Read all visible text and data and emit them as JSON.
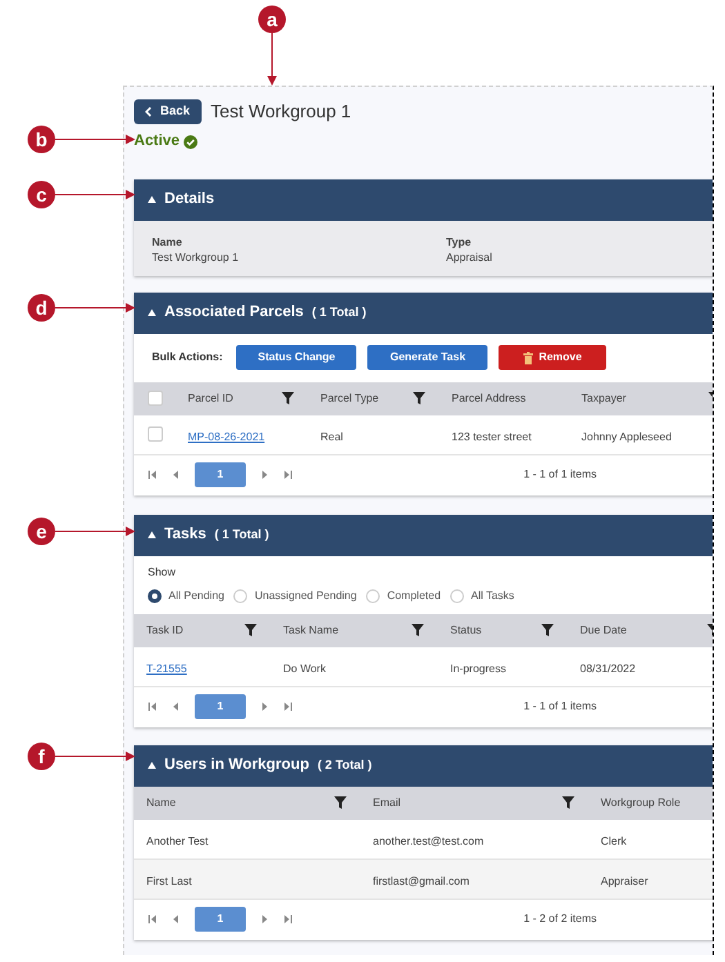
{
  "annotations": [
    {
      "label": "a"
    },
    {
      "label": "b"
    },
    {
      "label": "c"
    },
    {
      "label": "d"
    },
    {
      "label": "e"
    },
    {
      "label": "f"
    }
  ],
  "header": {
    "back_button": "Back",
    "title": "Test Workgroup 1",
    "status": "Active",
    "active": true
  },
  "sections": [
    {
      "kind": "details",
      "title": "Details",
      "expanded": true,
      "fields": [
        {
          "label": "Name",
          "value": "Test Workgroup 1"
        },
        {
          "label": "Type",
          "value": "Appraisal"
        }
      ]
    },
    {
      "kind": "table",
      "title": "Associated Parcels",
      "count": "( 1 Total )",
      "expanded": true,
      "bulk_actions": {
        "label": "Bulk Actions:",
        "buttons": [
          {
            "label": "Status Change",
            "kind": "primary"
          },
          {
            "label": "Generate Task",
            "kind": "primary"
          },
          {
            "label": "Remove",
            "kind": "danger"
          }
        ]
      },
      "select_all": {
        "checked": false
      },
      "columns": [
        {
          "label": "Parcel ID",
          "filter": true,
          "link": true
        },
        {
          "label": "Parcel Type",
          "filter": true,
          "link": false
        },
        {
          "label": "Parcel Address",
          "filter": false,
          "link": false
        },
        {
          "label": "Taxpayer",
          "filter": true,
          "link": false
        }
      ],
      "rows": [
        {
          "checked": false,
          "cells": [
            "MP-08-26-2021",
            "Real",
            "123 tester street",
            "Johnny Appleseed"
          ]
        }
      ],
      "pager": {
        "pages": [
          {
            "label": "1",
            "selected": true
          }
        ],
        "summary": "1 - 1 of 1 items"
      }
    },
    {
      "kind": "table",
      "title": "Tasks",
      "count": "( 1 Total )",
      "expanded": true,
      "filter_options": {
        "label": "Show",
        "options": [
          {
            "label": "All Pending",
            "selected": true
          },
          {
            "label": "Unassigned Pending",
            "selected": false
          },
          {
            "label": "Completed",
            "selected": false
          },
          {
            "label": "All Tasks",
            "selected": false
          }
        ]
      },
      "columns": [
        {
          "label": "Task ID",
          "filter": true,
          "link": true
        },
        {
          "label": "Task Name",
          "filter": true,
          "link": false
        },
        {
          "label": "Status",
          "filter": true,
          "link": false
        },
        {
          "label": "Due Date",
          "filter": true,
          "link": false
        }
      ],
      "rows": [
        {
          "cells": [
            "T-21555",
            "Do Work",
            "In-progress",
            "08/31/2022"
          ]
        }
      ],
      "pager": {
        "pages": [
          {
            "label": "1",
            "selected": true
          }
        ],
        "summary": "1 - 1 of 1 items"
      }
    },
    {
      "kind": "table",
      "title": "Users in Workgroup",
      "count": "( 2 Total )",
      "expanded": true,
      "columns": [
        {
          "label": "Name",
          "filter": true,
          "link": false
        },
        {
          "label": "Email",
          "filter": true,
          "link": false
        },
        {
          "label": "Workgroup Role",
          "filter": false,
          "link": false
        }
      ],
      "rows": [
        {
          "cells": [
            "Another Test",
            "another.test@test.com",
            "Clerk"
          ]
        },
        {
          "cells": [
            "First Last",
            "firstlast@gmail.com",
            "Appraiser"
          ]
        }
      ],
      "pager": {
        "pages": [
          {
            "label": "1",
            "selected": true
          }
        ],
        "summary": "1 - 2 of 2 items"
      }
    }
  ]
}
